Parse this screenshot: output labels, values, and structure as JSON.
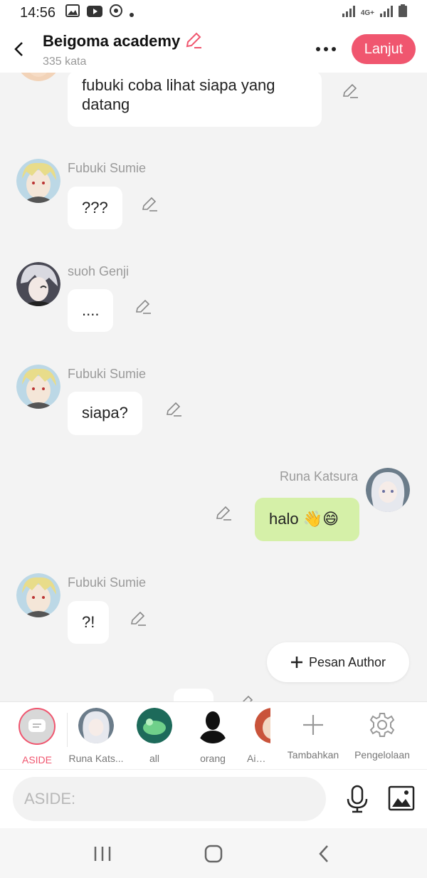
{
  "status_bar": {
    "time": "14:56",
    "network": "4G+"
  },
  "header": {
    "title": "Beigoma academy",
    "subtitle": "335 kata",
    "next_label": "Lanjut"
  },
  "messages": [
    {
      "sender": "",
      "text": "fubuki coba lihat siapa yang datang",
      "side": "left"
    },
    {
      "sender": "Fubuki Sumie",
      "text": "???",
      "side": "left"
    },
    {
      "sender": "suoh Genji",
      "text": "....",
      "side": "left"
    },
    {
      "sender": "Fubuki Sumie",
      "text": "siapa?",
      "side": "left"
    },
    {
      "sender": "Runa Katsura",
      "text": "halo 👋😄",
      "side": "right"
    },
    {
      "sender": "Fubuki Sumie",
      "text": "?!",
      "side": "left"
    }
  ],
  "author_button": {
    "label": "Pesan Author"
  },
  "characters": [
    {
      "label": "ASIDE",
      "selected": true
    },
    {
      "label": "Runa Kats..."
    },
    {
      "label": "all"
    },
    {
      "label": "orang"
    },
    {
      "label": "Aiga A"
    }
  ],
  "tools": {
    "add_label": "Tambahkan",
    "manage_label": "Pengelolaan"
  },
  "input": {
    "placeholder": "ASIDE:"
  },
  "colors": {
    "accent": "#f0566f",
    "bubble_mine": "#d5f0a8",
    "background": "#f3f3f3"
  },
  "icons": [
    "back-icon",
    "pencil-icon",
    "more-icon",
    "plus-icon",
    "gear-icon",
    "mic-icon",
    "image-icon"
  ]
}
